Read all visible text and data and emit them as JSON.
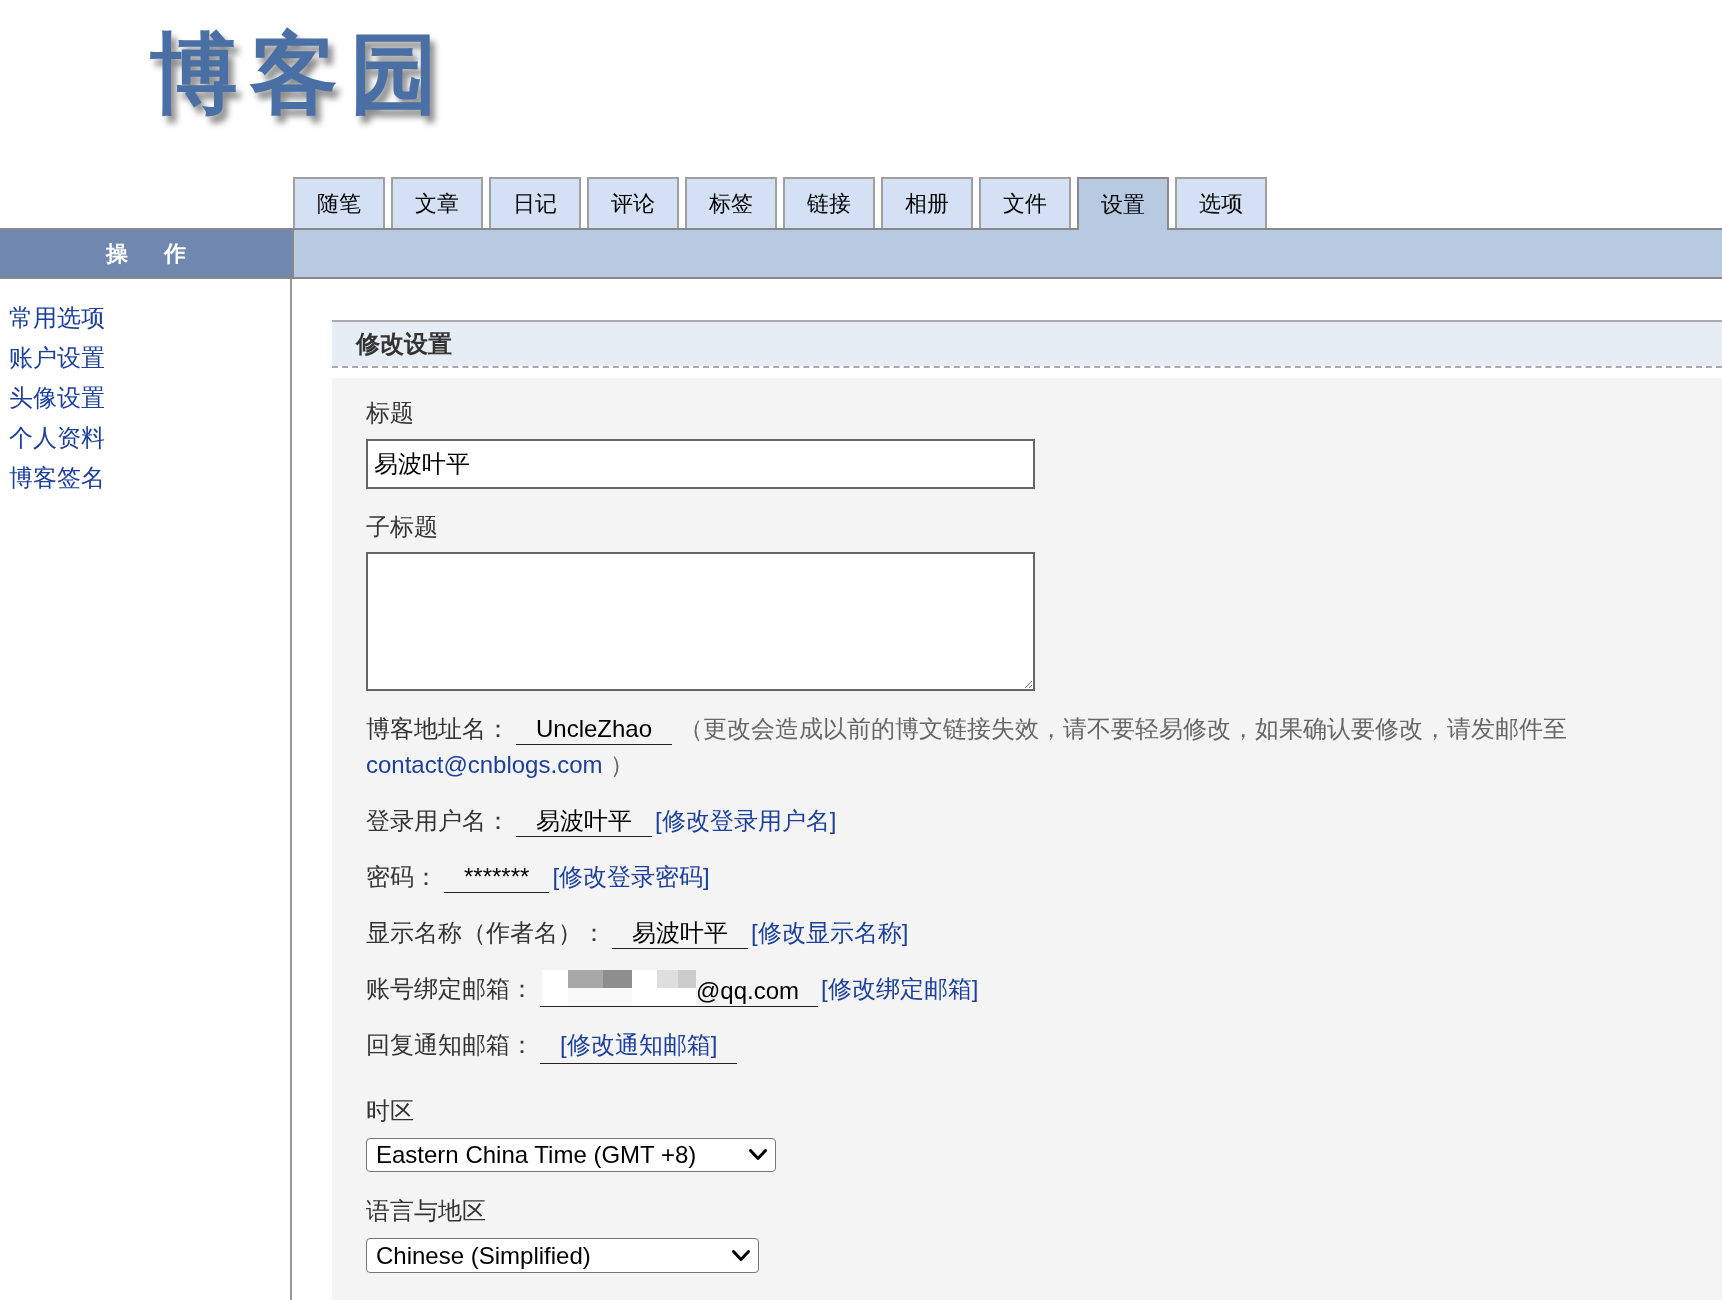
{
  "logo": "博客园",
  "tabs": [
    {
      "label": "随笔",
      "selected": false
    },
    {
      "label": "文章",
      "selected": false
    },
    {
      "label": "日记",
      "selected": false
    },
    {
      "label": "评论",
      "selected": false
    },
    {
      "label": "标签",
      "selected": false
    },
    {
      "label": "链接",
      "selected": false
    },
    {
      "label": "相册",
      "selected": false
    },
    {
      "label": "文件",
      "selected": false
    },
    {
      "label": "设置",
      "selected": true
    },
    {
      "label": "选项",
      "selected": false
    }
  ],
  "sidebar": {
    "title": "操 作",
    "items": [
      "常用选项",
      "账户设置",
      "头像设置",
      "个人资料",
      "博客签名"
    ]
  },
  "panel": {
    "title": "修改设置",
    "title_field": {
      "label": "标题",
      "value": "易波叶平"
    },
    "subtitle_field": {
      "label": "子标题"
    },
    "account_rows": [
      {
        "kind": "address",
        "label": "博客地址名：",
        "value": "UncleZhao",
        "masked": false,
        "note": "（更改会造成以前的博文链接失效，请不要轻易修改，如果确认要修改，请发邮件至",
        "note_link": "contact@cnblogs.com",
        "note_end": "）"
      },
      {
        "kind": "value",
        "label": "登录用户名：",
        "value": "易波叶平",
        "masked": false,
        "link": "[修改登录用户名]"
      },
      {
        "kind": "value",
        "label": "密码：",
        "value": "*******",
        "masked": false,
        "link": "[修改登录密码]"
      },
      {
        "kind": "value",
        "label": "显示名称（作者名）：",
        "value": "易波叶平",
        "masked": false,
        "link": "[修改显示名称]"
      },
      {
        "kind": "value",
        "label": "账号绑定邮箱：",
        "value": "@qq.com",
        "masked": true,
        "link": "[修改绑定邮箱]"
      },
      {
        "kind": "empty",
        "label": "回复通知邮箱：",
        "masked": false,
        "link": "[修改通知邮箱]"
      }
    ],
    "timezone": {
      "label": "时区",
      "value": "Eastern China Time (GMT +8)"
    },
    "language": {
      "label": "语言与地区",
      "value": "Chinese (Simplified)"
    }
  }
}
